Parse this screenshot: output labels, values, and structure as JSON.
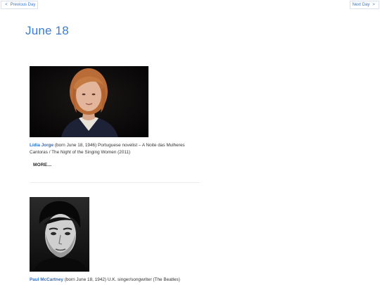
{
  "nav": {
    "prev_arrow": "<",
    "prev_label": "Previous Day",
    "next_label": "Next Day",
    "next_arrow": ">"
  },
  "page": {
    "title": "June 18"
  },
  "entries": [
    {
      "name": "Lídia Jorge",
      "description": " (born June 18, 1946) Portuguese novelist – A Noite das Mulheres Cantoras / The Night of the Singing Women (2011)",
      "more_label": "MORE..."
    },
    {
      "name": "Paul McCartney",
      "description": " (born June 18, 1942) U.K. singer/songwriter (The Beatles)"
    }
  ],
  "colors": {
    "accent": "#3a7bd5",
    "link": "#2a6fc9",
    "text": "#333333"
  }
}
